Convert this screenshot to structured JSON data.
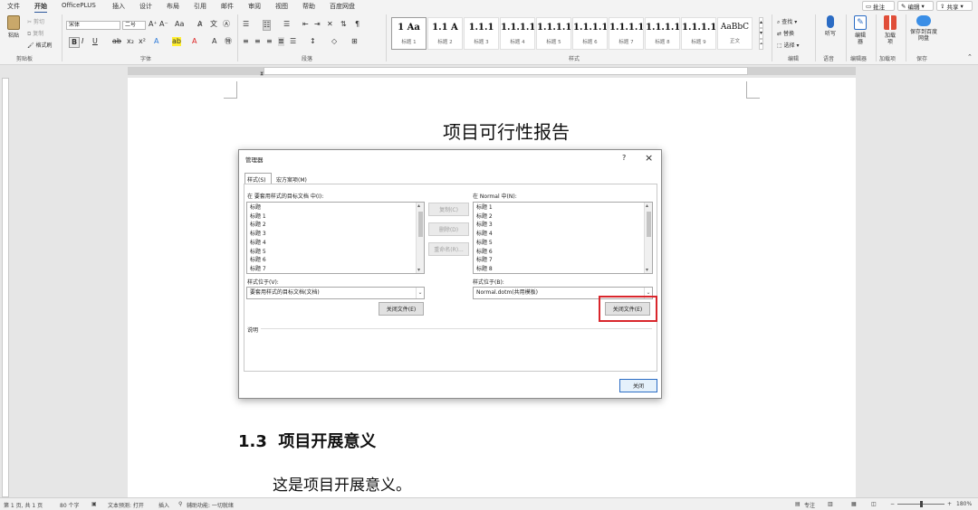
{
  "menubar": {
    "tabs": [
      "文件",
      "开始",
      "OfficePLUS",
      "插入",
      "设计",
      "布局",
      "引用",
      "邮件",
      "审阅",
      "视图",
      "帮助",
      "百度网盘"
    ],
    "active_tab": "开始",
    "comment_btn": "批注",
    "edit_btn": "编辑",
    "share_btn": "共享"
  },
  "ribbon": {
    "clipboard": {
      "paste": "粘贴",
      "cut": "剪切",
      "copy": "复制",
      "format_painter": "格式刷",
      "label": "剪贴板"
    },
    "font": {
      "font_name": "宋体",
      "font_size": "二号",
      "label": "字体"
    },
    "paragraph": {
      "label": "段落"
    },
    "styles": {
      "label": "样式",
      "items": [
        {
          "sample": "1 Aa",
          "name": "标题 1"
        },
        {
          "sample": "1.1 A",
          "name": "标题 2"
        },
        {
          "sample": "1.1.1",
          "name": "标题 3"
        },
        {
          "sample": "1.1.1.1",
          "name": "标题 4"
        },
        {
          "sample": "1.1.1.1",
          "name": "标题 5"
        },
        {
          "sample": "1.1.1.1",
          "name": "标题 6"
        },
        {
          "sample": "1.1.1.1",
          "name": "标题 7"
        },
        {
          "sample": "1.1.1.1",
          "name": "标题 8"
        },
        {
          "sample": "1.1.1.1",
          "name": "标题 9"
        },
        {
          "sample": "AaBbC",
          "name": "正文"
        }
      ]
    },
    "editing": {
      "find": "查找",
      "replace": "替换",
      "select": "选择",
      "label": "编辑"
    },
    "voice": {
      "dictate": "听写",
      "label": "语音"
    },
    "editor": {
      "btn": "编辑器",
      "label": "编辑器"
    },
    "addins": {
      "btn": "加载项",
      "label": "加载项"
    },
    "save": {
      "btn": "保存到百度网盘",
      "label": "保存"
    }
  },
  "document": {
    "title": "项目可行性报告",
    "heading": "1.3  项目开展意义",
    "body": "这是项目开展意义。"
  },
  "dialog": {
    "title": "管理器",
    "help": "?",
    "close_x": "×",
    "tabs": [
      "样式(S)",
      "宏方案项(M)"
    ],
    "left_label": "在 要套用样式的目标文档 中(I):",
    "left_items": [
      "标题",
      "标题 1",
      "标题 2",
      "标题 3",
      "标题 4",
      "标题 5",
      "标题 6",
      "标题 7"
    ],
    "right_label": "在 Normal 中(N):",
    "right_items": [
      "标题 1",
      "标题 2",
      "标题 3",
      "标题 4",
      "标题 5",
      "标题 6",
      "标题 7",
      "标题 8"
    ],
    "copy_btn": "复制(C)",
    "delete_btn": "删除(D)",
    "rename_btn": "重命名(R)...",
    "left_avail_label": "样式位于(V):",
    "left_avail_value": "要套用样式的目标文档(文档)",
    "right_avail_label": "样式位于(B):",
    "right_avail_value": "Normal.dotm(共用模板)",
    "left_close_file": "关闭文件(E)",
    "right_close_file": "关闭文件(E)",
    "desc_label": "说明",
    "close_btn": "关闭",
    "highlight_color": "#d9262c"
  },
  "status": {
    "page": "第 1 页, 共 1 页",
    "words": "80 个字",
    "text_predict": "文本预测: 打开",
    "insert": "插入",
    "accessibility": "辅助功能: 一切就绪",
    "focus": "专注",
    "zoom": "180%"
  }
}
